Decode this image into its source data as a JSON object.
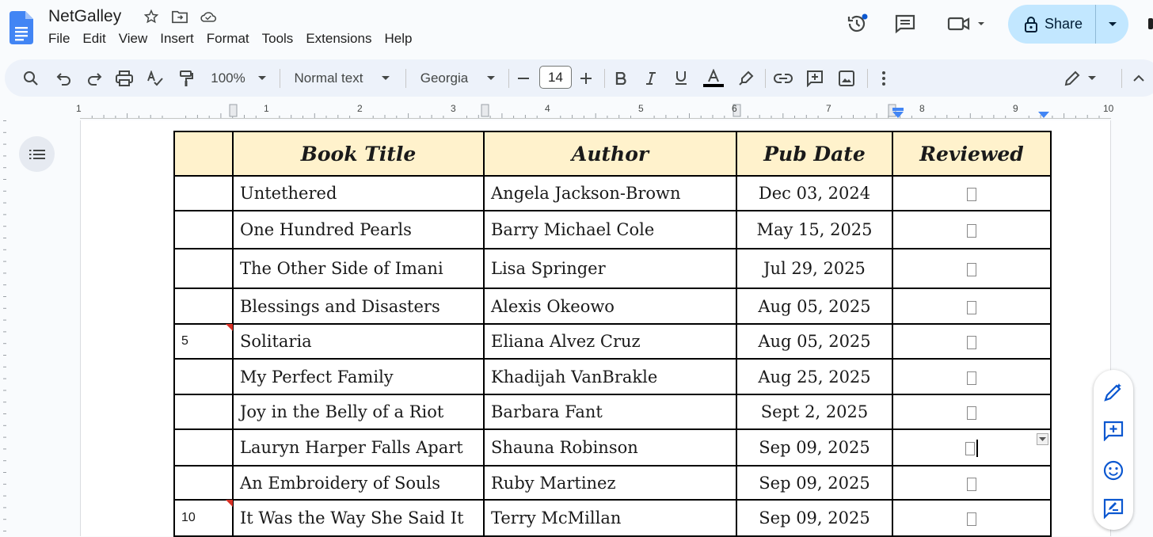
{
  "app": {
    "doc_title": "NetGalley",
    "menu": [
      "File",
      "Edit",
      "View",
      "Insert",
      "Format",
      "Tools",
      "Extensions",
      "Help"
    ],
    "share_label": "Share"
  },
  "toolbar": {
    "zoom": "100%",
    "style": "Normal text",
    "font": "Georgia",
    "font_size": "14"
  },
  "ruler": {
    "numbers": [
      "1",
      "1",
      "2",
      "3",
      "4",
      "5",
      "6",
      "7",
      "8",
      "9",
      "10"
    ]
  },
  "table": {
    "headers": [
      "",
      "Book Title",
      "Author",
      "Pub Date",
      "Reviewed"
    ],
    "rows": [
      {
        "num": "",
        "title": "Untethered",
        "author": "Angela Jackson-Brown",
        "date": "Dec 03, 2024"
      },
      {
        "num": "",
        "title": "One Hundred Pearls",
        "author": "Barry Michael Cole",
        "date": "May 15, 2025"
      },
      {
        "num": "",
        "title": "The Other Side of Imani",
        "author": "Lisa Springer",
        "date": "Jul 29, 2025"
      },
      {
        "num": "",
        "title": "Blessings and Disasters",
        "author": "Alexis Okeowo",
        "date": "Aug 05, 2025"
      },
      {
        "num": "5",
        "title": "Solitaria",
        "author": "Eliana Alvez Cruz",
        "date": "Aug 05, 2025"
      },
      {
        "num": "",
        "title": "My Perfect Family",
        "author": "Khadijah VanBrakle",
        "date": "Aug 25, 2025"
      },
      {
        "num": "",
        "title": "Joy in the Belly of a Riot",
        "author": "Barbara Fant",
        "date": "Sept 2, 2025"
      },
      {
        "num": "",
        "title": "Lauryn Harper Falls Apart",
        "author": "Shauna Robinson",
        "date": "Sep 09, 2025"
      },
      {
        "num": "",
        "title": "An Embroidery of Souls",
        "author": "Ruby Martinez",
        "date": "Sep 09, 2025"
      },
      {
        "num": "10",
        "title": "It Was the Way She Said It",
        "author": "Terry McMillan",
        "date": "Sep 09, 2025"
      }
    ]
  },
  "colors": {
    "header_fill": "#fff2cc",
    "share_bg": "#c2e7ff",
    "toolbar_bg": "#edf2fa",
    "accent": "#0b57d0",
    "comment_flag": "#d93025"
  }
}
